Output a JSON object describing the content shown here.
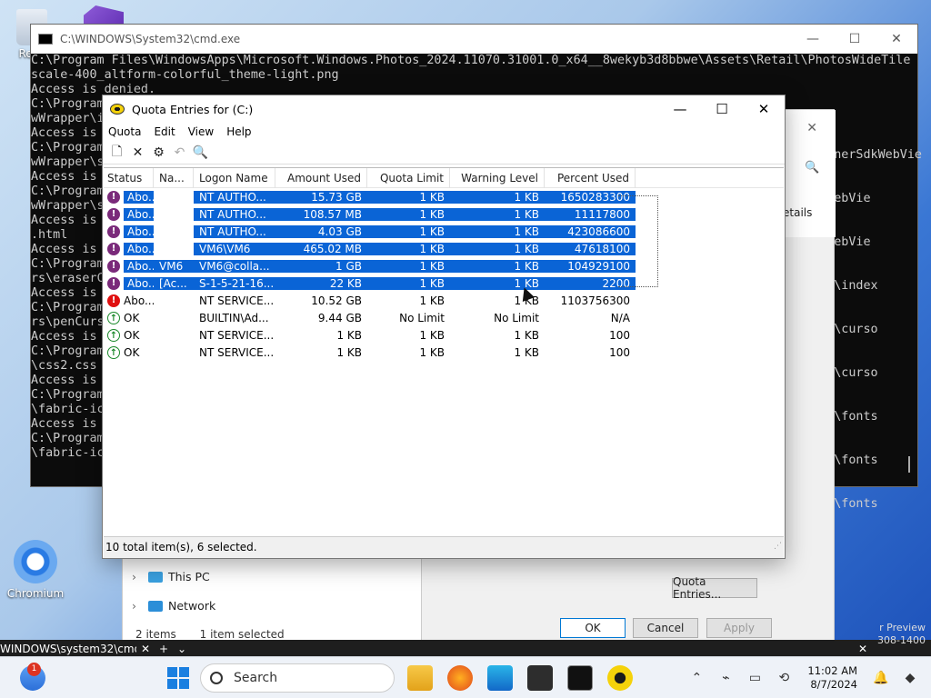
{
  "desktop": {
    "recycle_label": "Recy",
    "chromium_label": "Chromium"
  },
  "cmd": {
    "title": "C:\\WINDOWS\\System32\\cmd.exe",
    "lines": [
      "C:\\Program Files\\WindowsApps\\Microsoft.Windows.Photos_2024.11070.31001.0_x64__8wekyb3d8bbwe\\Assets\\Retail\\PhotosWideTile",
      "scale-400_altform-colorful_theme-light.png",
      "Access is denied.",
      "C:\\Program",
      "wWrapper\\i",
      "Access is",
      "C:\\Program",
      "wWrapper\\s",
      "Access is",
      "C:\\Program",
      "wWrapper\\s",
      "Access is",
      ".html",
      "Access is",
      "C:\\Program",
      "rs\\eraserC",
      "Access is",
      "C:\\Program",
      "rs\\penCurs",
      "Access is",
      "C:\\Program",
      "\\css2.css",
      "Access is",
      "C:\\Program",
      "\\fabric-ic",
      "Access is",
      "C:\\Program",
      "\\fabric-ic"
    ],
    "right_fragments": [
      "esignerSdkWebVie",
      "SdkWebVie",
      "SdkWebVie",
      "itor\\index",
      "itor\\curso",
      "itor\\curso",
      "itor\\fonts",
      "itor\\fonts",
      "itor\\fonts"
    ]
  },
  "props": {
    "details_label": "etails",
    "quota_entries_button": "Quota Entries...",
    "ok_button": "OK",
    "cancel_button": "Cancel",
    "apply_button": "Apply"
  },
  "explorer": {
    "this_pc": "This PC",
    "network": "Network",
    "items_count": "2 items",
    "selected_count": "1 item selected"
  },
  "quota": {
    "title": "Quota Entries for  (C:)",
    "menu": [
      "Quota",
      "Edit",
      "View",
      "Help"
    ],
    "columns": [
      "Status",
      "Na...",
      "Logon Name",
      "Amount Used",
      "Quota Limit",
      "Warning Level",
      "Percent Used"
    ],
    "rows": [
      {
        "status": "Abo...",
        "icon": "warn",
        "name": "",
        "logon": "NT AUTHO...",
        "amount": "15.73 GB",
        "limit": "1 KB",
        "warn": "1 KB",
        "pct": "1650283300",
        "selected": true
      },
      {
        "status": "Abo...",
        "icon": "warn",
        "name": "",
        "logon": "NT AUTHO...",
        "amount": "108.57 MB",
        "limit": "1 KB",
        "warn": "1 KB",
        "pct": "11117800",
        "selected": true
      },
      {
        "status": "Abo...",
        "icon": "warn",
        "name": "",
        "logon": "NT AUTHO...",
        "amount": "4.03 GB",
        "limit": "1 KB",
        "warn": "1 KB",
        "pct": "423086600",
        "selected": true
      },
      {
        "status": "Abo...",
        "icon": "warn",
        "name": "",
        "logon": "VM6\\VM6",
        "amount": "465.02 MB",
        "limit": "1 KB",
        "warn": "1 KB",
        "pct": "47618100",
        "selected": true
      },
      {
        "status": "Abo...",
        "icon": "warn",
        "name": "VM6",
        "logon": "VM6@colla...",
        "amount": "1 GB",
        "limit": "1 KB",
        "warn": "1 KB",
        "pct": "104929100",
        "selected": true
      },
      {
        "status": "Abo...",
        "icon": "warn",
        "name": "[Ac...",
        "logon": "S-1-5-21-16...",
        "amount": "22 KB",
        "limit": "1 KB",
        "warn": "1 KB",
        "pct": "2200",
        "selected": true
      },
      {
        "status": "Abo...",
        "icon": "err",
        "name": "",
        "logon": "NT SERVICE...",
        "amount": "10.52 GB",
        "limit": "1 KB",
        "warn": "1 KB",
        "pct": "1103756300",
        "selected": false
      },
      {
        "status": "OK",
        "icon": "ok",
        "name": "",
        "logon": "BUILTIN\\Ad...",
        "amount": "9.44 GB",
        "limit": "No Limit",
        "warn": "No Limit",
        "pct": "N/A",
        "selected": false
      },
      {
        "status": "OK",
        "icon": "ok",
        "name": "",
        "logon": "NT SERVICE...",
        "amount": "1 KB",
        "limit": "1 KB",
        "warn": "1 KB",
        "pct": "100",
        "selected": false
      },
      {
        "status": "OK",
        "icon": "ok",
        "name": "",
        "logon": "NT SERVICE...",
        "amount": "1 KB",
        "limit": "1 KB",
        "warn": "1 KB",
        "pct": "100",
        "selected": false
      }
    ],
    "status_bar": "10 total item(s), 6 selected."
  },
  "taskbar": {
    "tab_label": "WINDOWS\\system32\\cmd.",
    "search_placeholder": "Search",
    "notification_badge": "1",
    "preview_line1": "r Preview",
    "preview_line2": "308-1400",
    "time": "11:02 AM",
    "date": "8/7/2024"
  }
}
